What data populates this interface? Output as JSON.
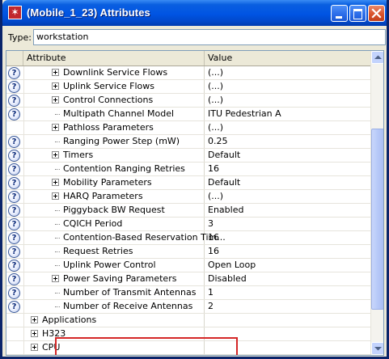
{
  "window": {
    "title": "(Mobile_1_23) Attributes",
    "icon_name": "app-star-icon",
    "title_bar_color": "#0054e3"
  },
  "type_field": {
    "label": "Type:",
    "value": "workstation"
  },
  "grid": {
    "columns": {
      "attribute": "Attribute",
      "value": "Value"
    },
    "rows": [
      {
        "label": "Downlink Service Flows",
        "value": "(...)",
        "help": true,
        "expandable": true,
        "indent": 1
      },
      {
        "label": "Uplink Service Flows",
        "value": "(...)",
        "help": true,
        "expandable": true,
        "indent": 1
      },
      {
        "label": "Control Connections",
        "value": "(...)",
        "help": true,
        "expandable": true,
        "indent": 1
      },
      {
        "label": "Multipath Channel Model",
        "value": "ITU Pedestrian A",
        "help": true,
        "expandable": false,
        "indent": 1
      },
      {
        "label": "Pathloss Parameters",
        "value": "(...)",
        "help": false,
        "expandable": true,
        "indent": 1
      },
      {
        "label": "Ranging Power Step (mW)",
        "value": "0.25",
        "help": true,
        "expandable": false,
        "indent": 1
      },
      {
        "label": "Timers",
        "value": "Default",
        "help": true,
        "expandable": true,
        "indent": 1
      },
      {
        "label": "Contention Ranging Retries",
        "value": "16",
        "help": true,
        "expandable": false,
        "indent": 1
      },
      {
        "label": "Mobility Parameters",
        "value": "Default",
        "help": true,
        "expandable": true,
        "indent": 1
      },
      {
        "label": "HARQ Parameters",
        "value": "(...)",
        "help": true,
        "expandable": true,
        "indent": 1
      },
      {
        "label": "Piggyback BW Request",
        "value": "Enabled",
        "help": true,
        "expandable": false,
        "indent": 1
      },
      {
        "label": "CQICH Period",
        "value": "3",
        "help": true,
        "expandable": false,
        "indent": 1
      },
      {
        "label": "Contention-Based Reservation Tim...",
        "value": "16",
        "help": true,
        "expandable": false,
        "indent": 1
      },
      {
        "label": "Request Retries",
        "value": "16",
        "help": true,
        "expandable": false,
        "indent": 1
      },
      {
        "label": "Uplink Power Control",
        "value": "Open Loop",
        "help": true,
        "expandable": false,
        "indent": 1
      },
      {
        "label": "Power Saving Parameters",
        "value": "Disabled",
        "help": true,
        "expandable": true,
        "indent": 1
      },
      {
        "label": "Number of Transmit Antennas",
        "value": "1",
        "help": true,
        "expandable": false,
        "indent": 1
      },
      {
        "label": "Number of Receive Antennas",
        "value": "2",
        "help": true,
        "expandable": false,
        "indent": 1
      },
      {
        "label": "Applications",
        "value": "",
        "help": false,
        "expandable": true,
        "indent": 0
      },
      {
        "label": "H323",
        "value": "",
        "help": false,
        "expandable": true,
        "indent": 0
      },
      {
        "label": "CPU",
        "value": "",
        "help": false,
        "expandable": true,
        "indent": 0
      }
    ]
  },
  "highlight": {
    "color": "#d42727"
  },
  "icons": {
    "help": "help-question-icon",
    "expand": "plus-expander-icon",
    "minimize": "minimize-icon",
    "maximize": "maximize-icon",
    "close": "close-icon",
    "scroll_up": "scroll-up-arrow-icon",
    "scroll_down": "scroll-down-arrow-icon"
  }
}
